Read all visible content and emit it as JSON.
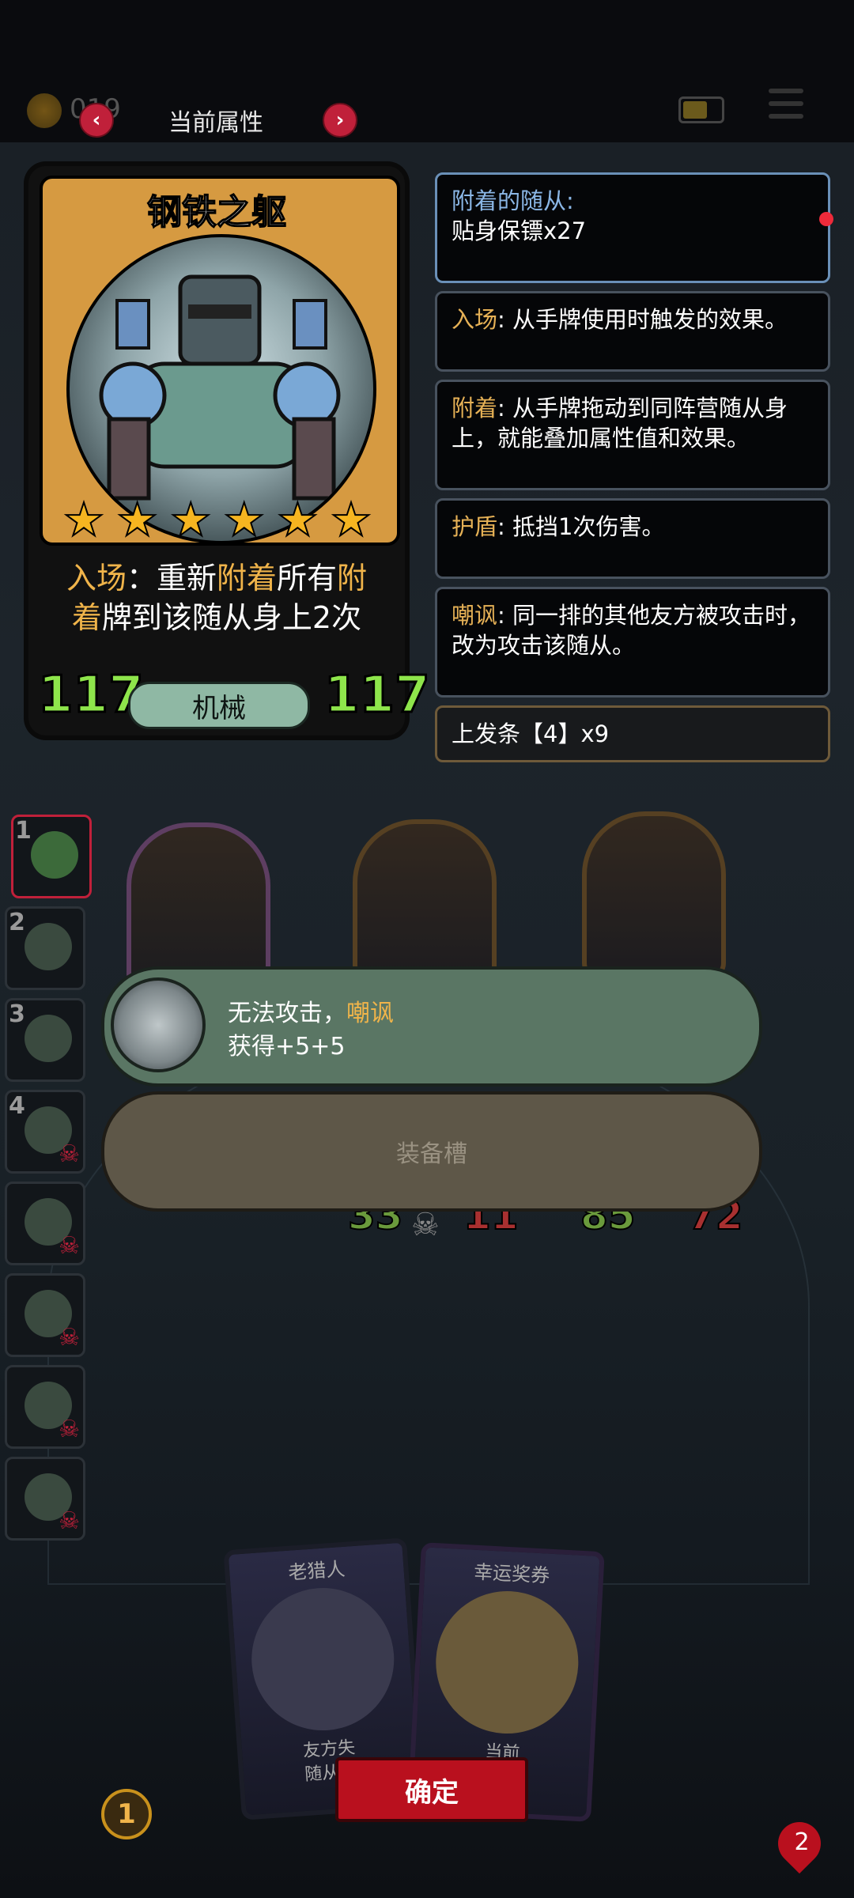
{
  "top_bar": {
    "coin_count": "019",
    "title": "当前属性",
    "prev_icon": "chevron-left-icon",
    "next_icon": "chevron-right-icon"
  },
  "card": {
    "title": "钢铁之躯",
    "stars": 6,
    "desc_line1_pre": "入场",
    "desc_line1_mid": "：重新",
    "desc_line1_kw": "附着",
    "desc_line1_post": "所有",
    "desc_line1_kw2": "附",
    "desc_line2_kw": "着",
    "desc_line2_post": "牌到该随从身上2次",
    "attack": "117",
    "health": "117",
    "tribe": "机械"
  },
  "info_panels": [
    {
      "keyword": "附着的随从:",
      "text": "贴身保镖x27"
    },
    {
      "keyword": "入场",
      "text": ": 从手牌使用时触发的效果。"
    },
    {
      "keyword": "附着",
      "text": ": 从手牌拖动到同阵营随从身上，就能叠加属性值和效果。"
    },
    {
      "keyword": "护盾",
      "text": ": 抵挡1次伤害。"
    },
    {
      "keyword": "嘲讽",
      "text": ": 同一排的其他友方被攻击时，改为攻击该随从。"
    },
    {
      "keyword": "",
      "text": "上发条【4】x9"
    }
  ],
  "roster": [
    {
      "num": "1",
      "selected": true,
      "dead": false
    },
    {
      "num": "2",
      "selected": false,
      "dead": false
    },
    {
      "num": "3",
      "selected": false,
      "dead": false
    },
    {
      "num": "4",
      "selected": false,
      "dead": true
    },
    {
      "num": "",
      "selected": false,
      "dead": true
    },
    {
      "num": "",
      "selected": false,
      "dead": true
    },
    {
      "num": "",
      "selected": false,
      "dead": true
    },
    {
      "num": "",
      "selected": false,
      "dead": true
    }
  ],
  "board": {
    "stats": [
      {
        "atk": "33",
        "hp": "11"
      },
      {
        "atk": "85",
        "hp": "72"
      }
    ]
  },
  "ability": {
    "line1_pre": "无法攻击，",
    "line1_kw": "嘲讽",
    "line2": "获得+5+5"
  },
  "equip_slot": {
    "label": "装备槽"
  },
  "hand": [
    {
      "title": "老猎人",
      "desc": "友方失\n随从获"
    },
    {
      "title": "幸运奖券",
      "desc": "当前\n随从"
    }
  ],
  "confirm": {
    "label": "确定"
  },
  "gold_level": "1",
  "life": "2",
  "colors": {
    "accent": "#f0b44a",
    "stat_green": "#8ee54b",
    "confirm_red": "#b9101e"
  }
}
